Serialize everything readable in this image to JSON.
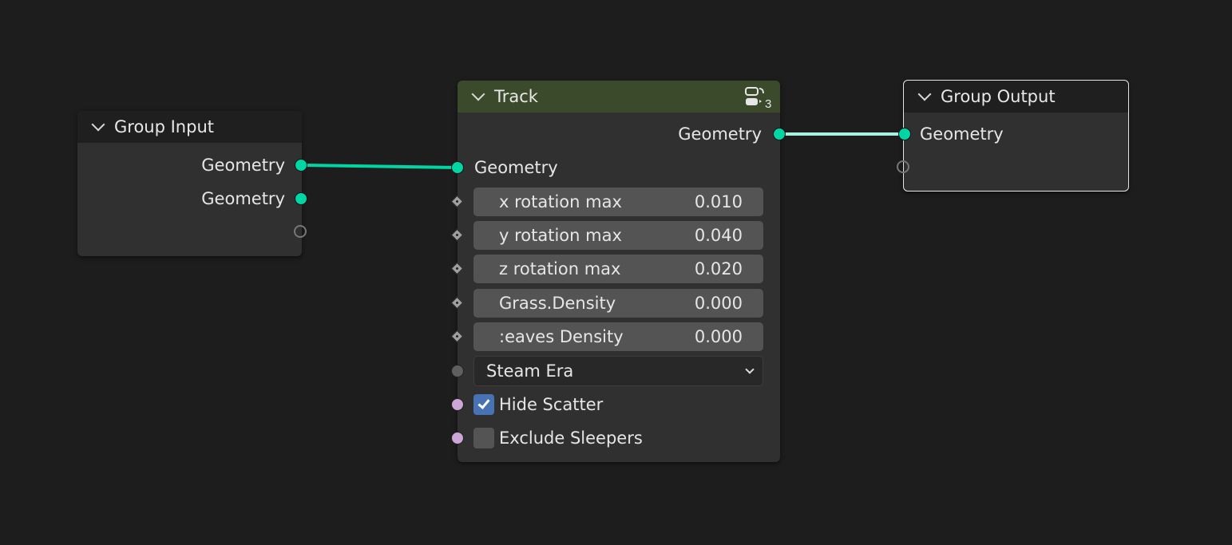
{
  "colors": {
    "background": "#1d1d1d",
    "node_body": "#303030",
    "group_header": "#1f1f1f",
    "track_header": "#3a4a2a",
    "geometry_socket": "#00d6a3",
    "boolean_socket": "#cca6d6",
    "checkbox_on": "#4772b3",
    "wire": "#00d6a3",
    "wire_highlight": "#a8f0dc"
  },
  "group_input": {
    "title": "Group Input",
    "outputs": [
      "Geometry",
      "Geometry"
    ]
  },
  "track": {
    "title": "Track",
    "user_count": "3",
    "output_label": "Geometry",
    "input_label": "Geometry",
    "fields": [
      {
        "label": "x rotation max",
        "value": "0.010"
      },
      {
        "label": "y rotation max",
        "value": "0.040"
      },
      {
        "label": "z rotation max",
        "value": "0.020"
      },
      {
        "label": "Grass.Density",
        "value": "0.000"
      },
      {
        "label": ":eaves Density",
        "value": "0.000"
      }
    ],
    "dropdown": {
      "selected": "Steam Era"
    },
    "checkboxes": [
      {
        "label": "Hide Scatter",
        "checked": true
      },
      {
        "label": "Exclude Sleepers",
        "checked": false
      }
    ]
  },
  "group_output": {
    "title": "Group Output",
    "inputs": [
      "Geometry"
    ]
  },
  "icons": {
    "node_group_users": "node-group-icon",
    "collapse": "chevron-down-icon"
  }
}
